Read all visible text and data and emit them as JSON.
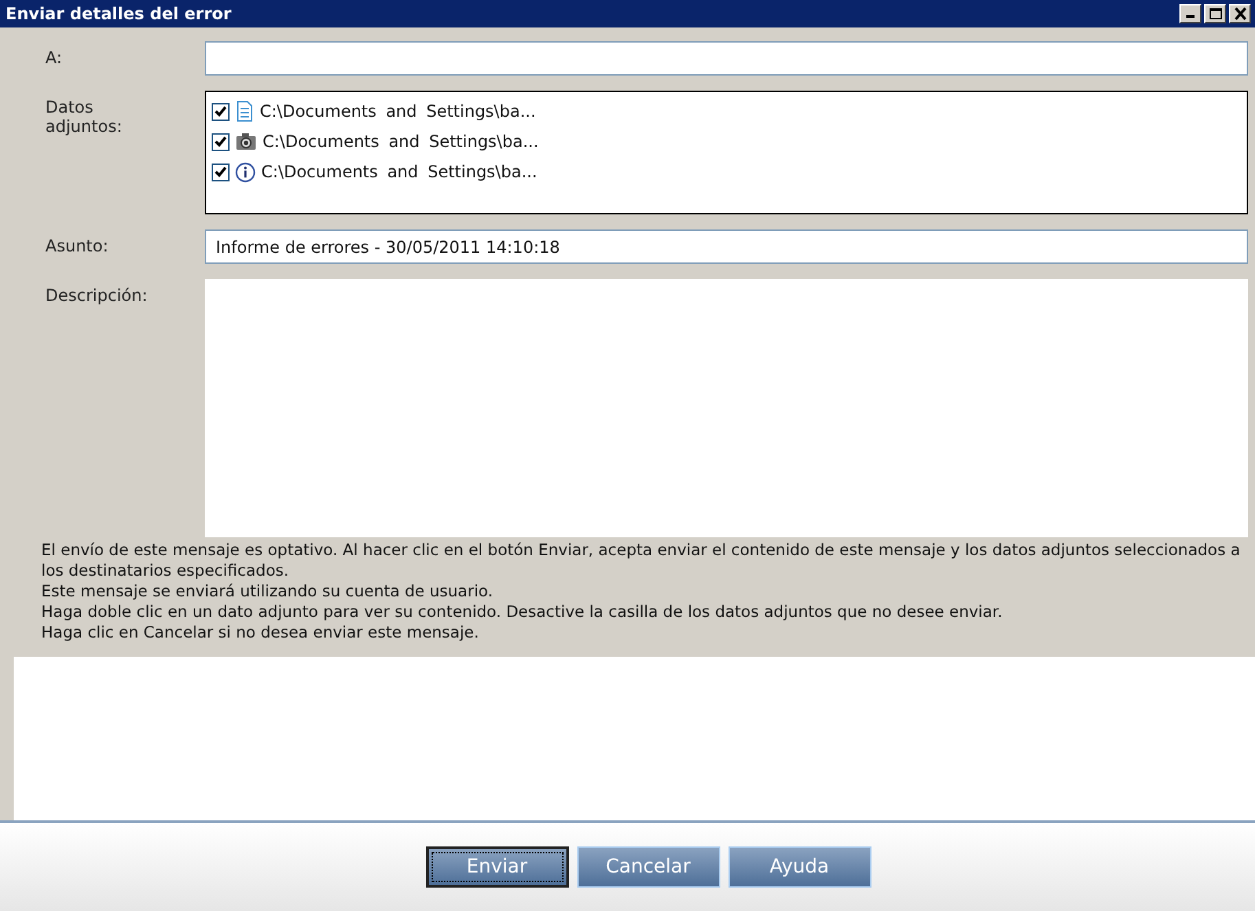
{
  "window": {
    "title": "Enviar detalles del error",
    "controls": [
      {
        "kind": "minimize"
      },
      {
        "kind": "maximize"
      },
      {
        "kind": "close"
      }
    ]
  },
  "to": {
    "label": "A:"
  },
  "attachments": {
    "label": "Datos adjuntos:",
    "items": [
      {
        "kind": "document",
        "checked": true,
        "path": "C:\\Documents and Settings\\ba..."
      },
      {
        "kind": "camera",
        "checked": true,
        "path": "C:\\Documents and Settings\\ba..."
      },
      {
        "kind": "info",
        "checked": true,
        "path": "C:\\Documents and Settings\\ba..."
      }
    ]
  },
  "subject": {
    "label": "Asunto:",
    "value": "Informe de errores - 30/05/2011 14:10:18"
  },
  "description": {
    "label": "Descripción:"
  },
  "notice": [
    "El envío de este mensaje es optativo.  Al hacer clic en el botón Enviar, acepta enviar el contenido de este mensaje y los datos adjuntos seleccionados a los destinatarios especificados.",
    "Este mensaje se enviará utilizando su cuenta de usuario.",
    "Haga doble clic en un dato adjunto para ver su contenido. Desactive la casilla de los datos adjuntos que no desee enviar.",
    "Haga clic en Cancelar si no desea enviar este mensaje."
  ],
  "buttons": [
    {
      "label": "Enviar",
      "focused": true
    },
    {
      "label": "Cancelar",
      "focused": false
    },
    {
      "label": "Ayuda",
      "focused": false
    }
  ]
}
